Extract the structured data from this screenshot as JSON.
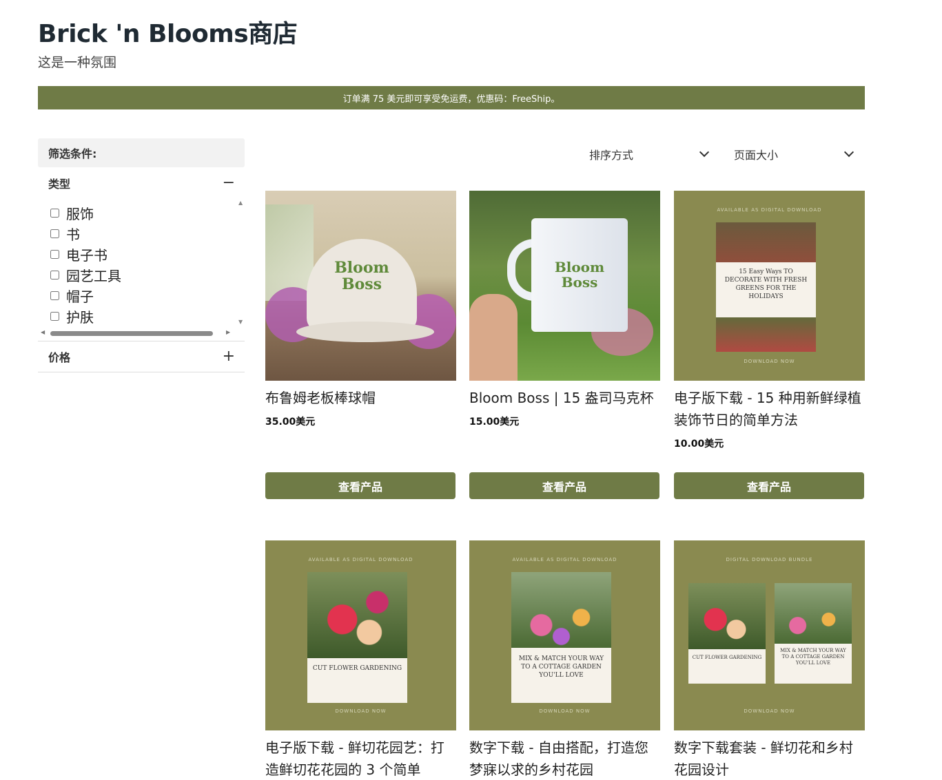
{
  "store": {
    "title": "Brick 'n Blooms商店",
    "subtitle": "这是一种氛围"
  },
  "promo": "订单满 75 美元即可享受免运费，优惠码：FreeShip。",
  "sidebar": {
    "filters_label": "筛选条件:",
    "type_label": "类型",
    "type_toggle": "−",
    "types": [
      "服饰",
      "书",
      "电子书",
      "园艺工具",
      "帽子",
      "护肤"
    ],
    "price_label": "价格",
    "price_toggle": "+"
  },
  "toolbar": {
    "sort_label": "排序方式",
    "page_size_label": "页面大小"
  },
  "products": [
    {
      "name": "布鲁姆老板棒球帽",
      "price": "35.00美元",
      "button": "查看产品",
      "image_text": "Bloom Boss"
    },
    {
      "name": "Bloom Boss | 15 盎司马克杯",
      "price": "15.00美元",
      "button": "查看产品",
      "image_text": "Bloom Boss"
    },
    {
      "name": "电子版下载 - 15 种用新鲜绿植装饰节日的简单方法",
      "price": "10.00美元",
      "button": "查看产品",
      "image_top": "AVAILABLE AS DIGITAL DOWNLOAD",
      "image_title": "15 Easy Ways TO DECORATE WITH FRESH GREENS FOR THE HOLIDAYS",
      "image_bottom": "DOWNLOAD NOW"
    },
    {
      "name": "电子版下载 - 鲜切花园艺：打造鲜切花花园的 3 个简单",
      "image_top": "AVAILABLE AS DIGITAL DOWNLOAD",
      "image_title": "CUT FLOWER GARDENING",
      "image_bottom": "DOWNLOAD NOW"
    },
    {
      "name": "数字下载 - 自由搭配，打造您梦寐以求的乡村花园",
      "image_top": "AVAILABLE AS DIGITAL DOWNLOAD",
      "image_title": "MIX & MATCH YOUR WAY TO A COTTAGE GARDEN YOU'LL LOVE",
      "image_bottom": "DOWNLOAD NOW"
    },
    {
      "name": "数字下载套装 - 鲜切花和乡村花园设计",
      "image_top": "DIGITAL DOWNLOAD BUNDLE",
      "image_title_a": "CUT FLOWER GARDENING",
      "image_title_b": "MIX & MATCH YOUR WAY TO A COTTAGE GARDEN YOU'LL LOVE",
      "image_bottom": "DOWNLOAD NOW"
    }
  ],
  "colors": {
    "brand_green": "#6f7b46",
    "olive_bg": "#8a8a50"
  }
}
